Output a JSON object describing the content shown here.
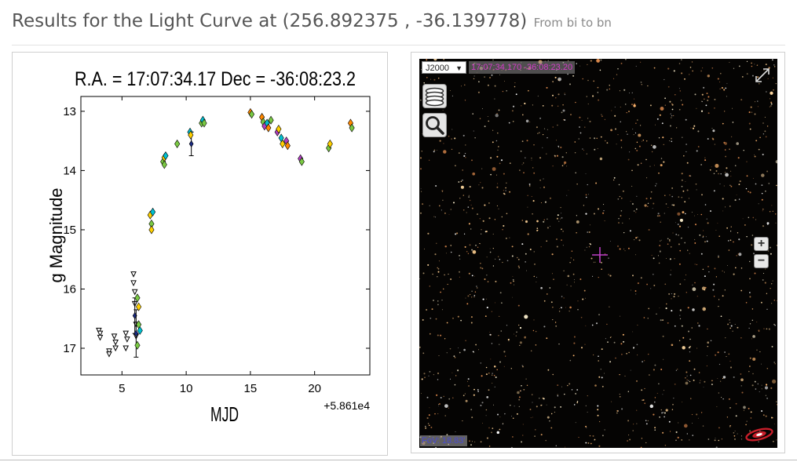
{
  "page": {
    "title": "Results for the Light Curve at (256.892375 , -36.139778)",
    "subtitle": "From bi to bn"
  },
  "chart_data": {
    "type": "scatter",
    "title": "R.A. = 17:07:34.17   Dec = -36:08:23.2",
    "xlabel": "MJD",
    "ylabel": "g Magnitude",
    "x_offset_label": "+5.861e4",
    "xlim": [
      1.8,
      24.3
    ],
    "ylim": [
      17.45,
      12.75
    ],
    "y_inverted": true,
    "xticks": [
      5,
      10,
      15,
      20
    ],
    "yticks": [
      13,
      14,
      15,
      16,
      17
    ],
    "grid": false,
    "detections": [
      {
        "x": 7.2,
        "y": 14.75,
        "color": "#ffd000"
      },
      {
        "x": 7.3,
        "y": 14.9,
        "color": "#7ac943"
      },
      {
        "x": 7.3,
        "y": 15.0,
        "color": "#ffd000"
      },
      {
        "x": 7.4,
        "y": 14.7,
        "color": "#00c0d0"
      },
      {
        "x": 8.2,
        "y": 13.85,
        "color": "#7ac943"
      },
      {
        "x": 8.3,
        "y": 13.78,
        "color": "#ffd000"
      },
      {
        "x": 8.3,
        "y": 13.9,
        "color": "#7ac943"
      },
      {
        "x": 8.4,
        "y": 13.75,
        "color": "#00c0d0"
      },
      {
        "x": 9.3,
        "y": 13.55,
        "color": "#7ac943"
      },
      {
        "x": 10.3,
        "y": 13.35,
        "color": "#00c0d0"
      },
      {
        "x": 10.35,
        "y": 13.4,
        "color": "#ffd000"
      },
      {
        "x": 11.2,
        "y": 13.2,
        "color": "#7ac943"
      },
      {
        "x": 11.3,
        "y": 13.15,
        "color": "#00c0d0"
      },
      {
        "x": 11.4,
        "y": 13.2,
        "color": "#7ac943"
      },
      {
        "x": 15.0,
        "y": 13.02,
        "color": "#ff8800"
      },
      {
        "x": 15.1,
        "y": 13.05,
        "color": "#7ac943"
      },
      {
        "x": 15.9,
        "y": 13.1,
        "color": "#ff8800"
      },
      {
        "x": 16.0,
        "y": 13.18,
        "color": "#7ac943"
      },
      {
        "x": 16.1,
        "y": 13.25,
        "color": "#b040c0"
      },
      {
        "x": 16.3,
        "y": 13.2,
        "color": "#00c0d0"
      },
      {
        "x": 16.4,
        "y": 13.28,
        "color": "#ff8800"
      },
      {
        "x": 16.6,
        "y": 13.15,
        "color": "#7ac943"
      },
      {
        "x": 17.1,
        "y": 13.35,
        "color": "#b040c0"
      },
      {
        "x": 17.2,
        "y": 13.3,
        "color": "#ffd000"
      },
      {
        "x": 17.4,
        "y": 13.45,
        "color": "#00c0d0"
      },
      {
        "x": 17.5,
        "y": 13.55,
        "color": "#ffd000"
      },
      {
        "x": 17.8,
        "y": 13.5,
        "color": "#b040c0"
      },
      {
        "x": 17.9,
        "y": 13.58,
        "color": "#ff8800"
      },
      {
        "x": 18.9,
        "y": 13.8,
        "color": "#b040c0"
      },
      {
        "x": 19.0,
        "y": 13.85,
        "color": "#7ac943"
      },
      {
        "x": 21.1,
        "y": 13.62,
        "color": "#7ac943"
      },
      {
        "x": 21.2,
        "y": 13.55,
        "color": "#ffd000"
      },
      {
        "x": 22.8,
        "y": 13.2,
        "color": "#ff8800"
      },
      {
        "x": 22.9,
        "y": 13.28,
        "color": "#7ac943"
      },
      {
        "x": 6.2,
        "y": 16.15,
        "color": "#7ac943"
      },
      {
        "x": 6.3,
        "y": 16.3,
        "color": "#ffd000"
      },
      {
        "x": 6.3,
        "y": 16.6,
        "color": "#7ac943"
      },
      {
        "x": 6.4,
        "y": 16.7,
        "color": "#00c0d0"
      },
      {
        "x": 6.2,
        "y": 16.95,
        "color": "#7ac943"
      }
    ],
    "black_points": [
      {
        "x": 10.4,
        "y": 13.55,
        "err": 0.2
      },
      {
        "x": 6.0,
        "y": 16.45,
        "err": 0.3
      },
      {
        "x": 6.1,
        "y": 16.75,
        "err": 0.4
      }
    ],
    "upper_limits": [
      {
        "x": 3.2,
        "y": 16.7
      },
      {
        "x": 3.3,
        "y": 16.75
      },
      {
        "x": 3.3,
        "y": 16.82
      },
      {
        "x": 4.0,
        "y": 17.05
      },
      {
        "x": 4.0,
        "y": 17.1
      },
      {
        "x": 4.4,
        "y": 16.8
      },
      {
        "x": 4.5,
        "y": 16.9
      },
      {
        "x": 4.5,
        "y": 17.0
      },
      {
        "x": 5.3,
        "y": 16.75
      },
      {
        "x": 5.4,
        "y": 16.85
      },
      {
        "x": 5.3,
        "y": 17.0
      },
      {
        "x": 5.9,
        "y": 15.75
      },
      {
        "x": 5.9,
        "y": 15.9
      },
      {
        "x": 6.0,
        "y": 16.05
      },
      {
        "x": 6.0,
        "y": 16.25
      },
      {
        "x": 6.1,
        "y": 16.6
      },
      {
        "x": 6.1,
        "y": 16.8
      }
    ]
  },
  "sky_viewer": {
    "frame_label": "J2000",
    "coordinates": "17:07:34.170 -36:08:23.20",
    "fov_label": "FoV: 18.83'",
    "zoom_in_label": "+",
    "zoom_out_label": "−",
    "layers_icon": "layers-icon",
    "search_icon": "search-icon",
    "fullscreen_icon": "fullscreen-icon",
    "logo_icon": "aladin-logo"
  }
}
